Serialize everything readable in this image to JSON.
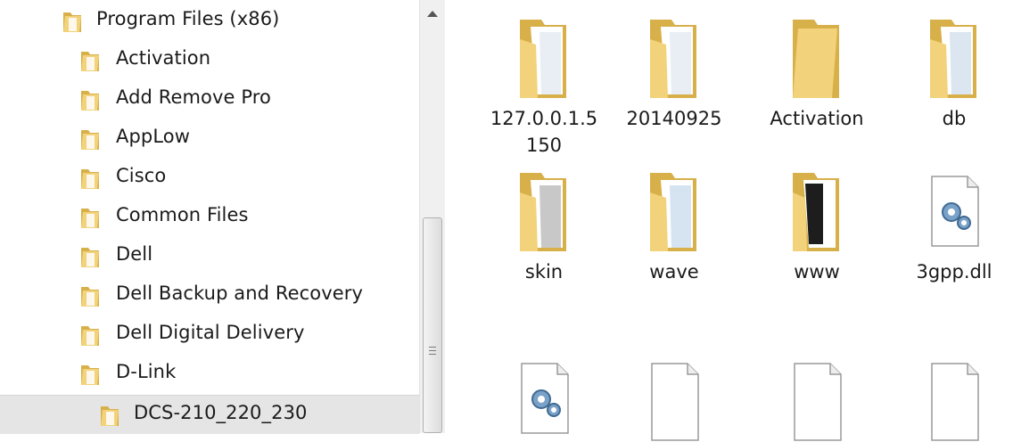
{
  "tree": {
    "items": [
      {
        "label": "Program Files (x86)"
      },
      {
        "label": "Activation"
      },
      {
        "label": "Add Remove Pro"
      },
      {
        "label": "AppLow"
      },
      {
        "label": "Cisco"
      },
      {
        "label": "Common Files"
      },
      {
        "label": "Dell"
      },
      {
        "label": "Dell Backup and Recovery"
      },
      {
        "label": "Dell Digital Delivery"
      },
      {
        "label": "D-Link"
      },
      {
        "label": "DCS-210_220_230",
        "selected": true
      }
    ]
  },
  "content": {
    "items": [
      {
        "name": "127.0.0.1.5150",
        "icon": "folder-icon"
      },
      {
        "name": "20140925",
        "icon": "folder-icon"
      },
      {
        "name": "Activation",
        "icon": "folder-icon"
      },
      {
        "name": "db",
        "icon": "folder-icon"
      },
      {
        "name": "skin",
        "icon": "folder-icon"
      },
      {
        "name": "wave",
        "icon": "folder-icon"
      },
      {
        "name": "www",
        "icon": "folder-icon"
      },
      {
        "name": "3gpp.dll",
        "icon": "dll-file-icon"
      },
      {
        "name": "",
        "icon": "dll-file-icon"
      },
      {
        "name": "",
        "icon": "file-icon"
      },
      {
        "name": "",
        "icon": "file-icon"
      },
      {
        "name": "",
        "icon": "file-icon"
      }
    ]
  },
  "colors": {
    "folder": "#f2d27a",
    "folder_dark": "#d8b04a",
    "selection": "#e5e5e5"
  }
}
